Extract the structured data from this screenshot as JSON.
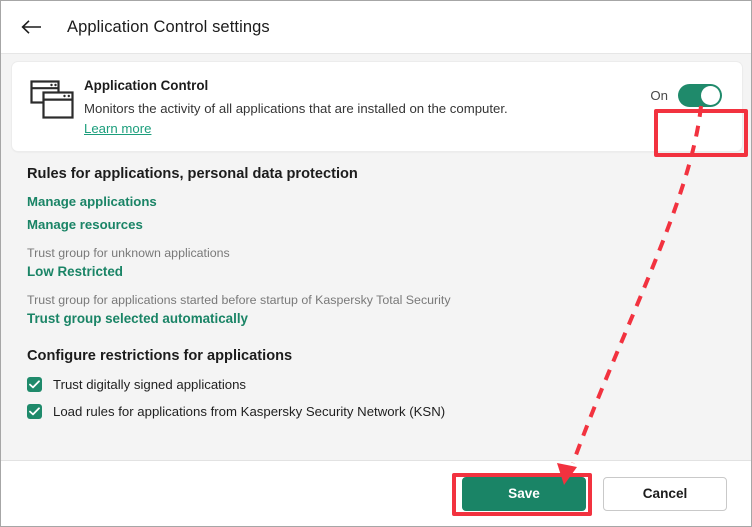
{
  "window": {
    "title": "Application Control settings",
    "back_icon": "back-arrow-icon"
  },
  "card": {
    "icon": "application-windows-icon",
    "title": "Application Control",
    "description": "Monitors the activity of all applications that are installed on the computer.",
    "learn_more": "Learn more",
    "toggle": {
      "label": "On",
      "state": "on"
    }
  },
  "sections": {
    "rules": {
      "heading": "Rules for applications, personal data protection",
      "links": [
        {
          "label": "Manage applications"
        },
        {
          "label": "Manage resources"
        }
      ],
      "fields": [
        {
          "label": "Trust group for unknown applications",
          "value": "Low Restricted"
        },
        {
          "label": "Trust group for applications started before startup of Kaspersky Total Security",
          "value": "Trust group selected automatically"
        }
      ]
    },
    "restrictions": {
      "heading": "Configure restrictions for applications",
      "checkboxes": [
        {
          "label": "Trust digitally signed applications",
          "checked": true
        },
        {
          "label": "Load rules for applications from Kaspersky Security Network (KSN)",
          "checked": true
        }
      ]
    }
  },
  "footer": {
    "save_label": "Save",
    "cancel_label": "Cancel"
  },
  "annotations": {
    "toggle_highlight": "red-highlight-box",
    "save_highlight": "red-highlight-box",
    "arrow": "red-dashed-arrow"
  },
  "colors": {
    "accent_green": "#1a8466",
    "toggle_green": "#1f8a6b",
    "link_green": "#1c9e7c",
    "annotation_red": "#f2323f",
    "page_background": "#f4f4f4"
  }
}
